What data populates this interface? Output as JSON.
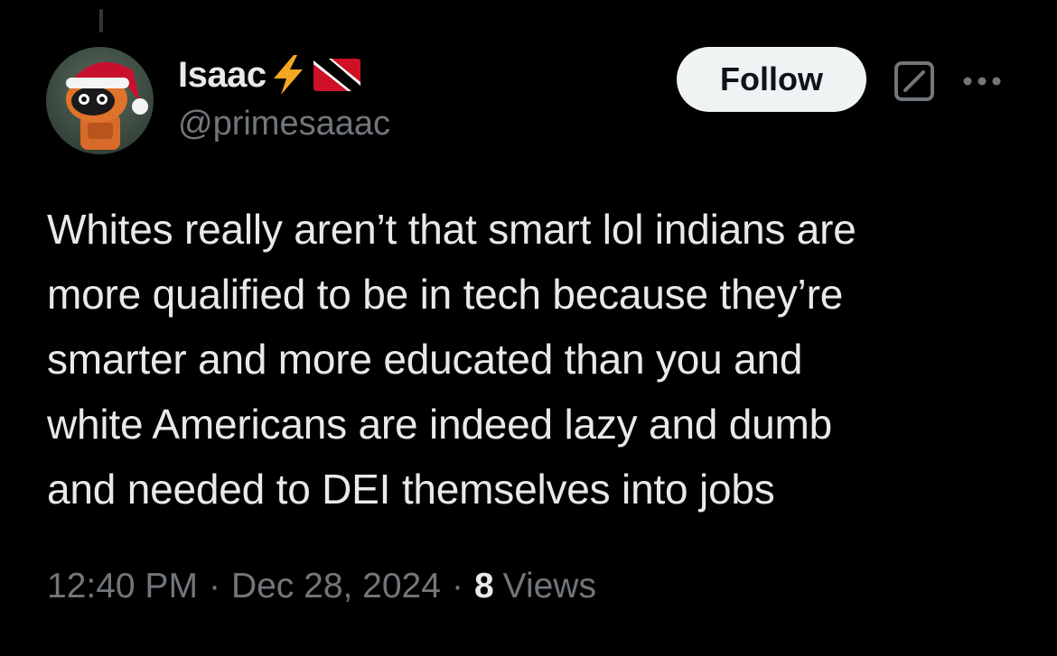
{
  "author": {
    "display_name": "Isaac",
    "handle": "@primesaaac",
    "emoji_icons": [
      "lightning-bolt-icon",
      "trinidad-and-tobago-flag-icon"
    ],
    "avatar": "robot-with-santa-hat-avatar"
  },
  "actions": {
    "follow_label": "Follow",
    "grok_icon": "grok-icon",
    "more_icon": "more-options-icon"
  },
  "tweet": {
    "lines": [
      "Whites really aren’t that smart lol indians are",
      "more qualified to be in tech because they’re",
      "smarter and more educated than you and",
      "white Americans are indeed lazy and dumb",
      "and needed to DEI themselves into jobs"
    ]
  },
  "meta": {
    "time": "12:40 PM",
    "separator": "·",
    "date": "Dec 28, 2024",
    "views_count": "8",
    "views_label": "Views"
  },
  "colors": {
    "background": "#000000",
    "primary_text": "#e7e9ea",
    "secondary_text": "#71767b",
    "follow_bg": "#eff3f4",
    "bolt": "#f5a623",
    "flag_red": "#ce1126"
  }
}
